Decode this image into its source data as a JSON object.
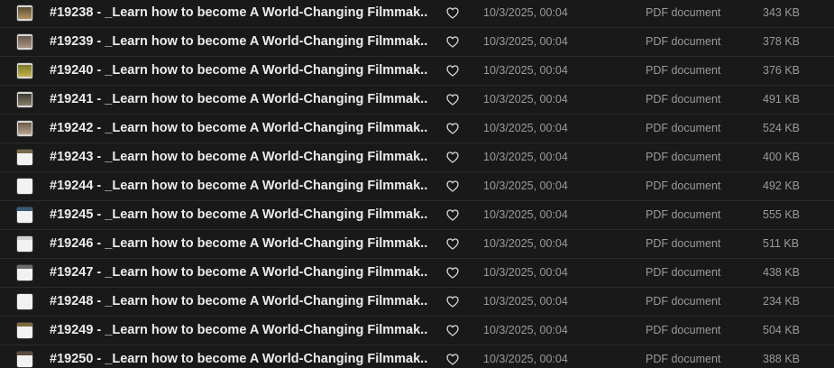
{
  "files": [
    {
      "name": "#19238 - _Learn how to become A World-Changing Filmmak...",
      "date": "10/3/2025, 00:04",
      "kind": "PDF document",
      "size": "343 KB",
      "thumbnail": {
        "style": "photo",
        "colors": [
          "#5a4a2e",
          "#b49564"
        ]
      }
    },
    {
      "name": "#19239 - _Learn how to become A World-Changing Filmmak...",
      "date": "10/3/2025, 00:04",
      "kind": "PDF document",
      "size": "378 KB",
      "thumbnail": {
        "style": "photo",
        "colors": [
          "#6b5a50",
          "#a89484"
        ]
      }
    },
    {
      "name": "#19240 - _Learn how to become A World-Changing Filmmak...",
      "date": "10/3/2025, 00:04",
      "kind": "PDF document",
      "size": "376 KB",
      "thumbnail": {
        "style": "photo",
        "colors": [
          "#7a7a2a",
          "#c6b24a"
        ]
      }
    },
    {
      "name": "#19241 - _Learn how to become A World-Changing Filmmak...",
      "date": "10/3/2025, 00:04",
      "kind": "PDF document",
      "size": "491 KB",
      "thumbnail": {
        "style": "photo",
        "colors": [
          "#3d3a30",
          "#8a8068"
        ]
      }
    },
    {
      "name": "#19242 - _Learn how to become A World-Changing Filmmak...",
      "date": "10/3/2025, 00:04",
      "kind": "PDF document",
      "size": "524 KB",
      "thumbnail": {
        "style": "photo",
        "colors": [
          "#6a5a48",
          "#b8a892"
        ]
      }
    },
    {
      "name": "#19243 - _Learn how to become A World-Changing Filmmak...",
      "date": "10/3/2025, 00:04",
      "kind": "PDF document",
      "size": "400 KB",
      "thumbnail": {
        "style": "page",
        "colors": [
          "#7a6a4a"
        ]
      }
    },
    {
      "name": "#19244 - _Learn how to become A World-Changing Filmmak...",
      "date": "10/3/2025, 00:04",
      "kind": "PDF document",
      "size": "492 KB",
      "thumbnail": {
        "style": "page",
        "colors": [
          "#f2f2f2"
        ]
      }
    },
    {
      "name": "#19245 - _Learn how to become A World-Changing Filmmak...",
      "date": "10/3/2025, 00:04",
      "kind": "PDF document",
      "size": "555 KB",
      "thumbnail": {
        "style": "page",
        "colors": [
          "#3a5a7a"
        ]
      }
    },
    {
      "name": "#19246 - _Learn how to become A World-Changing Filmmak...",
      "date": "10/3/2025, 00:04",
      "kind": "PDF document",
      "size": "511 KB",
      "thumbnail": {
        "style": "page",
        "colors": [
          "#d0d0d0"
        ]
      }
    },
    {
      "name": "#19247 - _Learn how to become A World-Changing Filmmak...",
      "date": "10/3/2025, 00:04",
      "kind": "PDF document",
      "size": "438 KB",
      "thumbnail": {
        "style": "page",
        "colors": [
          "#6a6a6a"
        ]
      }
    },
    {
      "name": "#19248 - _Learn how to become A World-Changing Filmmak...",
      "date": "10/3/2025, 00:04",
      "kind": "PDF document",
      "size": "234 KB",
      "thumbnail": {
        "style": "page",
        "colors": [
          "#f2f2f2"
        ]
      }
    },
    {
      "name": "#19249 - _Learn how to become A World-Changing Filmmak...",
      "date": "10/3/2025, 00:04",
      "kind": "PDF document",
      "size": "504 KB",
      "thumbnail": {
        "style": "page",
        "colors": [
          "#7a6a3a"
        ]
      }
    },
    {
      "name": "#19250 - _Learn how to become A World-Changing Filmmak...",
      "date": "10/3/2025, 00:04",
      "kind": "PDF document",
      "size": "388 KB",
      "thumbnail": {
        "style": "page",
        "colors": [
          "#5a4a3a"
        ]
      }
    }
  ],
  "icons": {
    "favorite": "heart-outline-icon"
  },
  "colors": {
    "background": "#191919",
    "row_divider": "#2b2b2b",
    "name_text": "#ececec",
    "meta_text": "#9a9a9a"
  }
}
